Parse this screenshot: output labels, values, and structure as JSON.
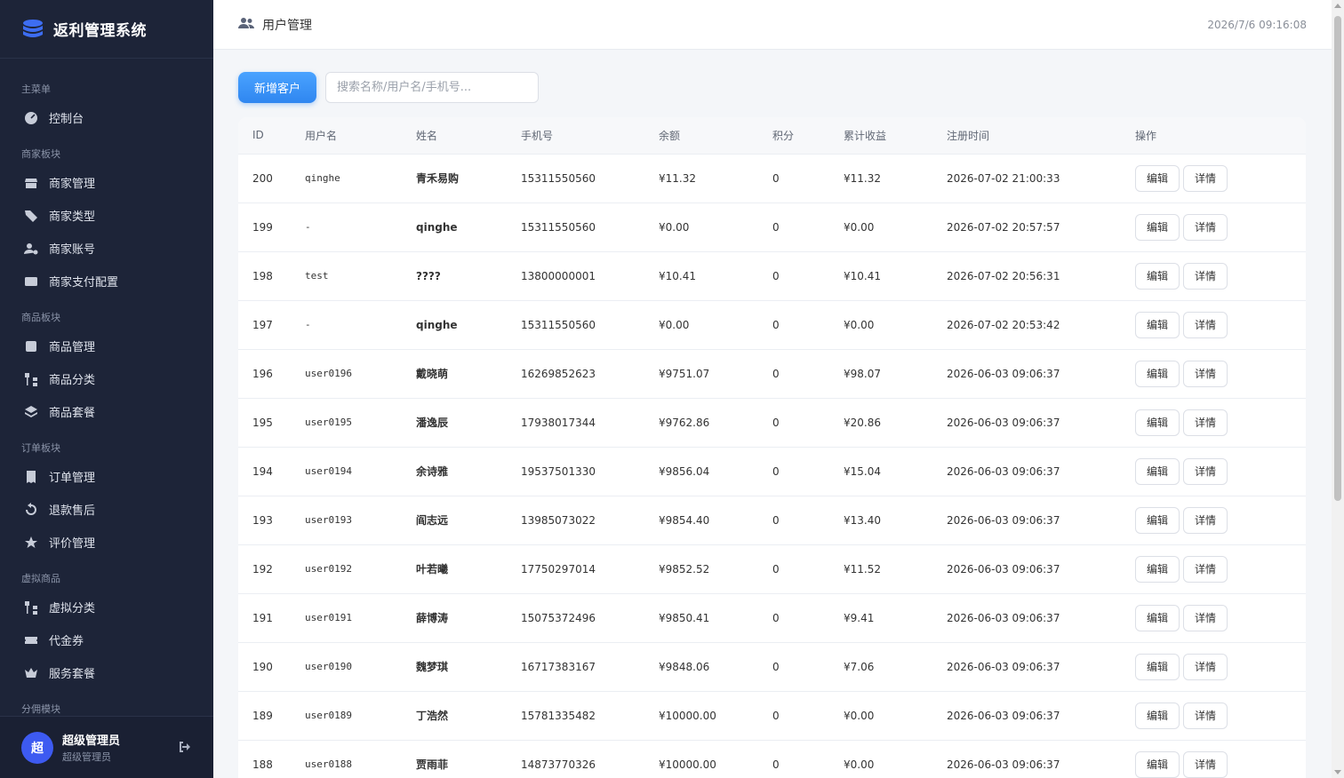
{
  "app": {
    "title": "返利管理系统"
  },
  "sidebar": {
    "groups": [
      {
        "title": "主菜单",
        "items": [
          {
            "label": "控制台",
            "icon": "dashboard-icon"
          }
        ]
      },
      {
        "title": "商家板块",
        "items": [
          {
            "label": "商家管理",
            "icon": "store-icon"
          },
          {
            "label": "商家类型",
            "icon": "tags-icon"
          },
          {
            "label": "商家账号",
            "icon": "user-gear-icon"
          },
          {
            "label": "商家支付配置",
            "icon": "credit-card-icon"
          }
        ]
      },
      {
        "title": "商品板块",
        "items": [
          {
            "label": "商品管理",
            "icon": "box-icon"
          },
          {
            "label": "商品分类",
            "icon": "sitemap-icon"
          },
          {
            "label": "商品套餐",
            "icon": "layers-icon"
          }
        ]
      },
      {
        "title": "订单板块",
        "items": [
          {
            "label": "订单管理",
            "icon": "receipt-icon"
          },
          {
            "label": "退款售后",
            "icon": "undo-icon"
          },
          {
            "label": "评价管理",
            "icon": "star-icon"
          }
        ]
      },
      {
        "title": "虚拟商品",
        "items": [
          {
            "label": "虚拟分类",
            "icon": "sitemap-icon"
          },
          {
            "label": "代金券",
            "icon": "ticket-icon"
          },
          {
            "label": "服务套餐",
            "icon": "crown-icon"
          }
        ]
      },
      {
        "title": "分佣模块",
        "items": []
      }
    ],
    "user": {
      "avatar": "超",
      "name": "超级管理员",
      "role": "超级管理员"
    }
  },
  "header": {
    "title": "用户管理",
    "datetime": "2026/7/6 09:16:08"
  },
  "toolbar": {
    "add_label": "新增客户",
    "search_placeholder": "搜索名称/用户名/手机号..."
  },
  "table": {
    "columns": [
      "ID",
      "用户名",
      "姓名",
      "手机号",
      "余额",
      "积分",
      "累计收益",
      "注册时间",
      "操作"
    ],
    "edit_label": "编辑",
    "detail_label": "详情",
    "rows": [
      {
        "id": "200",
        "username": "qinghe",
        "name": "青禾易购",
        "phone": "15311550560",
        "balance": "¥11.32",
        "points": "0",
        "earnings": "¥11.32",
        "registered": "2026-07-02 21:00:33"
      },
      {
        "id": "199",
        "username": "-",
        "name": "qinghe",
        "phone": "15311550560",
        "balance": "¥0.00",
        "points": "0",
        "earnings": "¥0.00",
        "registered": "2026-07-02 20:57:57"
      },
      {
        "id": "198",
        "username": "test",
        "name": "????",
        "phone": "13800000001",
        "balance": "¥10.41",
        "points": "0",
        "earnings": "¥10.41",
        "registered": "2026-07-02 20:56:31"
      },
      {
        "id": "197",
        "username": "-",
        "name": "qinghe",
        "phone": "15311550560",
        "balance": "¥0.00",
        "points": "0",
        "earnings": "¥0.00",
        "registered": "2026-07-02 20:53:42"
      },
      {
        "id": "196",
        "username": "user0196",
        "name": "戴晓萌",
        "phone": "16269852623",
        "balance": "¥9751.07",
        "points": "0",
        "earnings": "¥98.07",
        "registered": "2026-06-03 09:06:37"
      },
      {
        "id": "195",
        "username": "user0195",
        "name": "潘逸辰",
        "phone": "17938017344",
        "balance": "¥9762.86",
        "points": "0",
        "earnings": "¥20.86",
        "registered": "2026-06-03 09:06:37"
      },
      {
        "id": "194",
        "username": "user0194",
        "name": "余诗雅",
        "phone": "19537501330",
        "balance": "¥9856.04",
        "points": "0",
        "earnings": "¥15.04",
        "registered": "2026-06-03 09:06:37"
      },
      {
        "id": "193",
        "username": "user0193",
        "name": "阎志远",
        "phone": "13985073022",
        "balance": "¥9854.40",
        "points": "0",
        "earnings": "¥13.40",
        "registered": "2026-06-03 09:06:37"
      },
      {
        "id": "192",
        "username": "user0192",
        "name": "叶若曦",
        "phone": "17750297014",
        "balance": "¥9852.52",
        "points": "0",
        "earnings": "¥11.52",
        "registered": "2026-06-03 09:06:37"
      },
      {
        "id": "191",
        "username": "user0191",
        "name": "薛博涛",
        "phone": "15075372496",
        "balance": "¥9850.41",
        "points": "0",
        "earnings": "¥9.41",
        "registered": "2026-06-03 09:06:37"
      },
      {
        "id": "190",
        "username": "user0190",
        "name": "魏梦琪",
        "phone": "16717383167",
        "balance": "¥9848.06",
        "points": "0",
        "earnings": "¥7.06",
        "registered": "2026-06-03 09:06:37"
      },
      {
        "id": "189",
        "username": "user0189",
        "name": "丁浩然",
        "phone": "15781335482",
        "balance": "¥10000.00",
        "points": "0",
        "earnings": "¥0.00",
        "registered": "2026-06-03 09:06:37"
      },
      {
        "id": "188",
        "username": "user0188",
        "name": "贾雨菲",
        "phone": "14873770326",
        "balance": "¥10000.00",
        "points": "0",
        "earnings": "¥0.00",
        "registered": "2026-06-03 09:06:37"
      }
    ]
  }
}
